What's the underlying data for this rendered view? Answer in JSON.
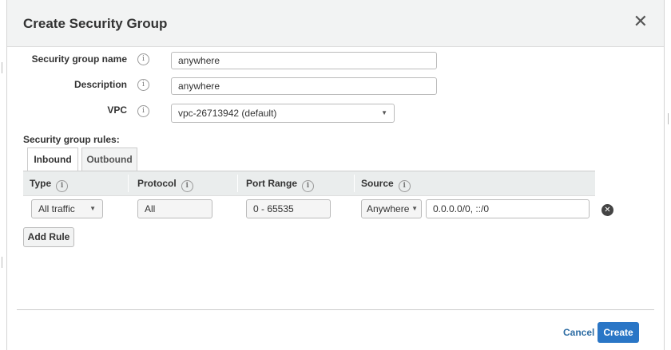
{
  "dialog": {
    "title": "Create Security Group",
    "close_icon": "close-icon"
  },
  "form": {
    "name_label": "Security group name",
    "name_value": "anywhere",
    "description_label": "Description",
    "description_value": "anywhere",
    "vpc_label": "VPC",
    "vpc_value": "vpc-26713942 (default)",
    "info_glyph": "i"
  },
  "rules": {
    "section_label": "Security group rules:",
    "tabs": [
      {
        "label": "Inbound",
        "active": true
      },
      {
        "label": "Outbound",
        "active": false
      }
    ],
    "columns": [
      "Type",
      "Protocol",
      "Port Range",
      "Source"
    ],
    "rows": [
      {
        "type": "All traffic",
        "protocol": "All",
        "port_range": "0 - 65535",
        "source_select": "Anywhere",
        "source_value": "0.0.0.0/0, ::/0"
      }
    ],
    "add_rule_label": "Add Rule"
  },
  "footer": {
    "cancel_label": "Cancel",
    "create_label": "Create"
  },
  "colors": {
    "primary": "#2a76c6",
    "link": "#2e6da4"
  }
}
